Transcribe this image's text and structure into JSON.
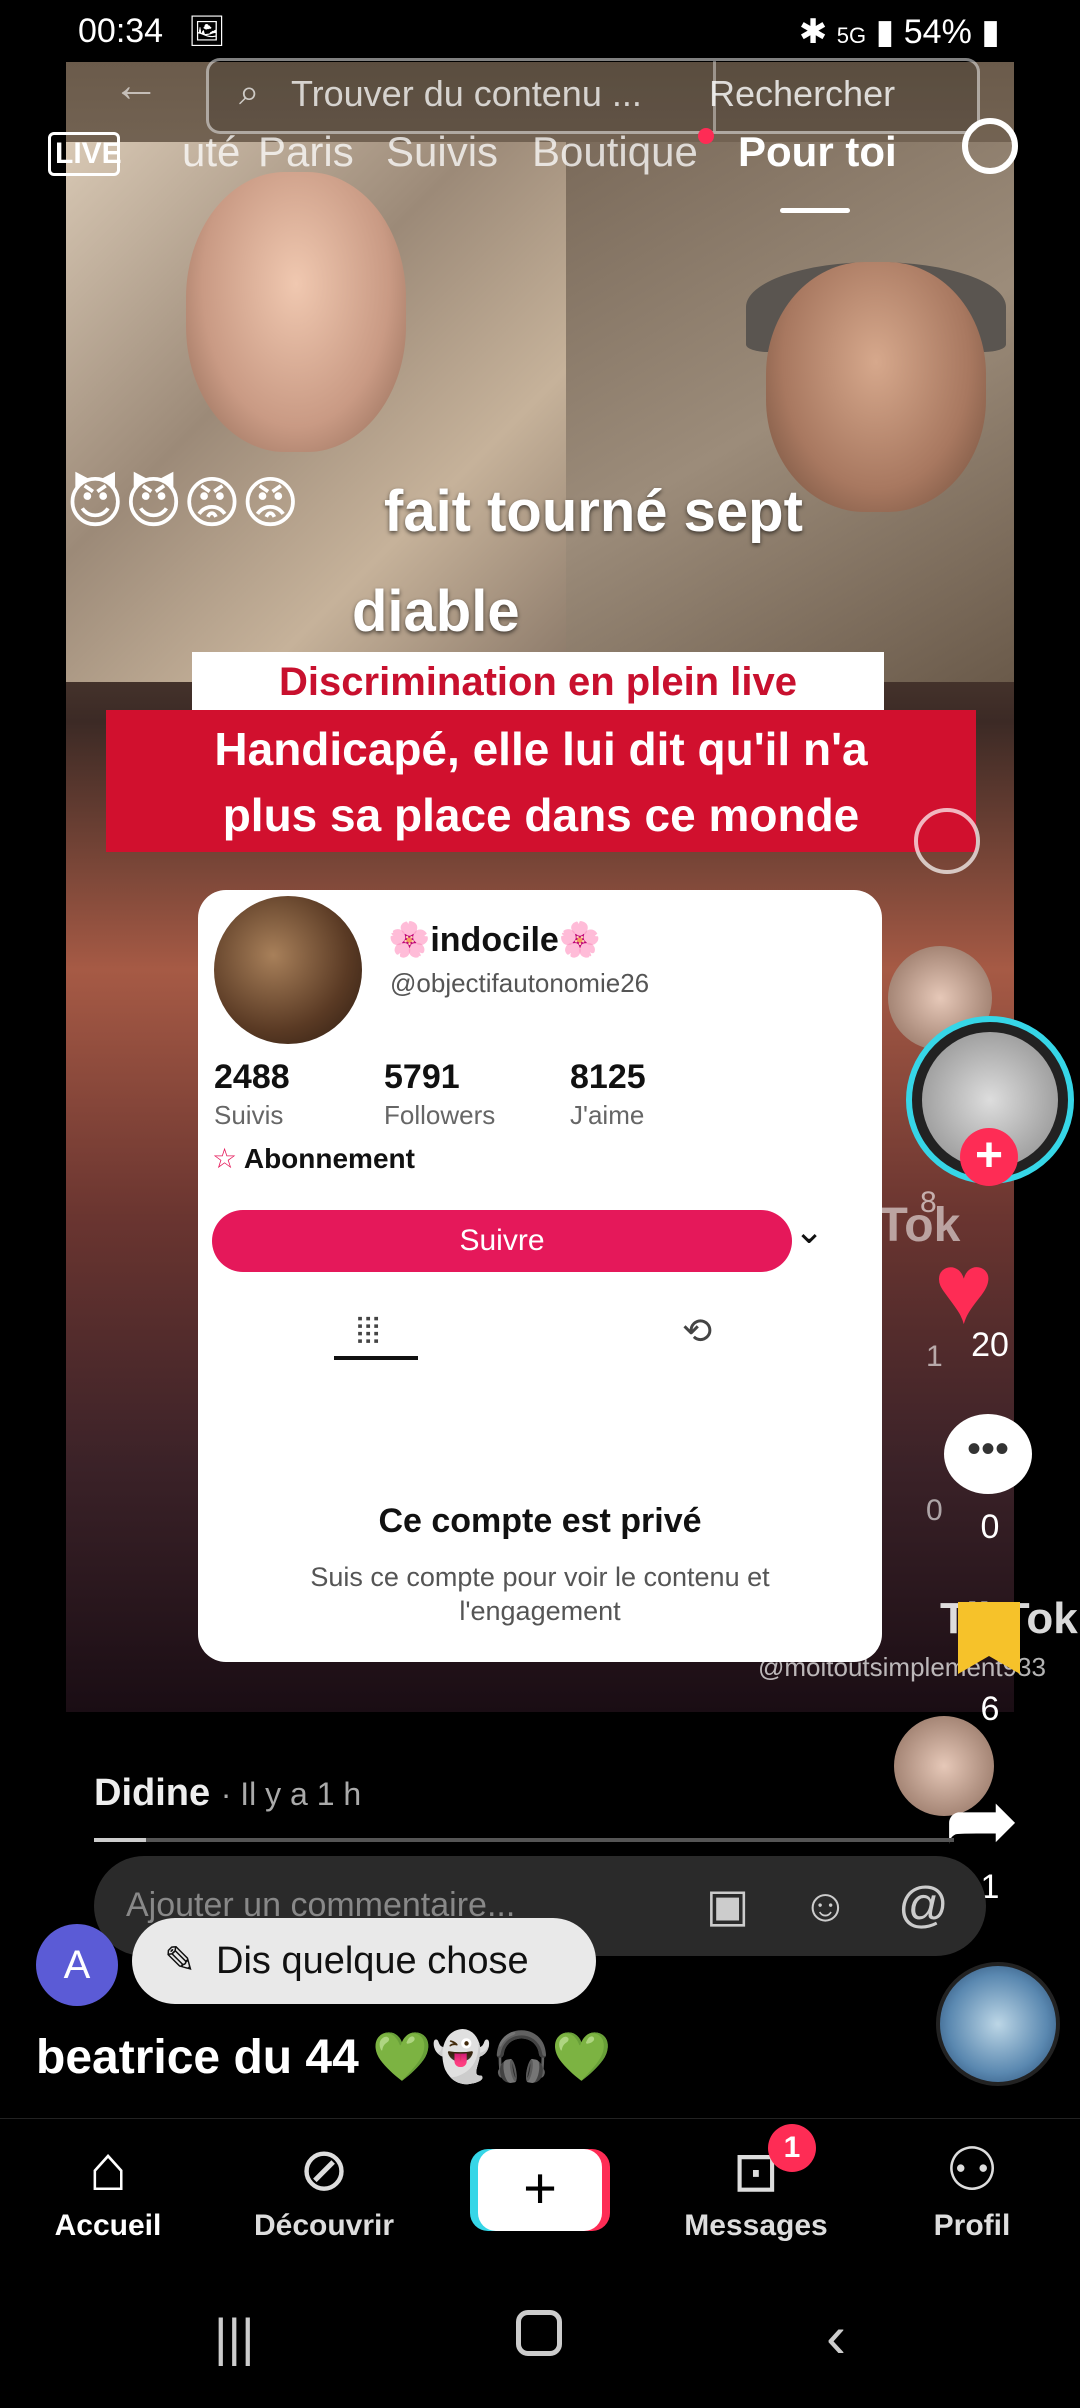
{
  "status_bar": {
    "time": "00:34",
    "battery": "54%",
    "network": "5G"
  },
  "top": {
    "search_placeholder": "Trouver du contenu ...",
    "search_button": "Rechercher",
    "live_label": "LIVE",
    "tabs": [
      "uté",
      "Paris",
      "Suivis",
      "Boutique",
      "Pour toi"
    ],
    "active_tab": "Pour toi"
  },
  "video": {
    "overlay_line1": "fait tourné sept",
    "overlay_line2": "diable",
    "banner_small": "Discrimination en plein live",
    "banner_big_line1": "Handicapé, elle lui dit qu'il n'a",
    "banner_big_line2": "plus sa place dans ce monde",
    "watermark_brand": "TikTok",
    "watermark_handle": "@moitoutsimplement933",
    "card": {
      "name": "indocile",
      "handle": "@objectifautonomie26",
      "stats": [
        {
          "value": "2488",
          "label": "Suivis"
        },
        {
          "value": "5791",
          "label": "Followers"
        },
        {
          "value": "8125",
          "label": "J'aime"
        }
      ],
      "subscription": "Abonnement",
      "follow_button": "Suivre",
      "private_title": "Ce compte est privé",
      "private_sub": "Suis ce compte pour voir le contenu et l'engagement"
    }
  },
  "rail": {
    "likes": "20",
    "comments": "0",
    "bookmarks": "6",
    "shares": "1",
    "bg_likes": "8",
    "bg_comments": "1",
    "bg_bookmarks": "0"
  },
  "comment": {
    "author": "Didine",
    "time": "· Il y a 1 h",
    "placeholder": "Ajouter un commentaire...",
    "progress": 0.06
  },
  "say": {
    "avatar_letter": "A",
    "label": "Dis quelque chose"
  },
  "username": "beatrice du 44 💚👻🎧💚",
  "nav": {
    "items": [
      {
        "label": "Accueil"
      },
      {
        "label": "Découvrir"
      },
      {
        "label": "Messages",
        "badge": "1"
      },
      {
        "label": "Profil"
      }
    ]
  },
  "colors": {
    "like": "#fe2c55",
    "accent_cyan": "#36d6e7",
    "follow": "#e5185a",
    "bookmark": "#f6c22a"
  }
}
